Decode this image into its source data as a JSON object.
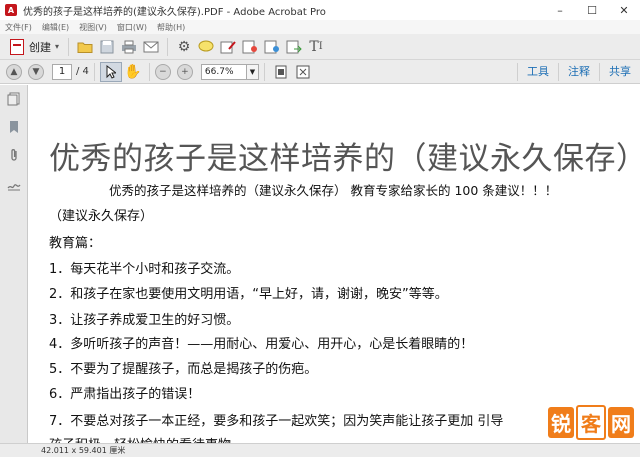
{
  "window": {
    "title": "优秀的孩子是这样培养的(建议永久保存).PDF - Adobe Acrobat Pro",
    "minimize": "–",
    "maximize": "☐",
    "close": "✕"
  },
  "menu": [
    "文件(F)",
    "编辑(E)",
    "视图(V)",
    "窗口(W)",
    "帮助(H)"
  ],
  "toolbar": {
    "create_label": "创建",
    "create_caret": "▾",
    "icons": [
      "open-folder-icon",
      "save-icon",
      "print-icon",
      "email-icon",
      "settings-icon",
      "comment-icon",
      "sign-icon",
      "stamp-icon",
      "attach-icon",
      "export-icon",
      "text-tool-icon"
    ]
  },
  "nav": {
    "current_page": "1",
    "total_pages": "/ 4",
    "zoom": "66.7%",
    "tabs": [
      "工具",
      "注释",
      "共享"
    ]
  },
  "document": {
    "title": "优秀的孩子是这样培养的（建议永久保存）",
    "subtitle": "优秀的孩子是这样培养的（建议永久保存）  教育专家给家长的 100 条建议！！！",
    "lines": [
      "（建议永久保存）",
      "教育篇：",
      "1．每天花半个小时和孩子交流。",
      "2．和孩子在家也要使用文明用语，“早上好，请，谢谢，晚安”等等。",
      "3．让孩子养成爱卫生的好习惯。",
      "4．多听听孩子的声音！——用耐心、用爱心、用开心，心是长着眼睛的！",
      "5．不要为了提醒孩子，而总是揭孩子的伤疤。",
      "6．严肃指出孩子的错误！",
      "7．不要总对孩子一本正经，要多和孩子一起欢笑；因为笑声能让孩子更加   引导",
      "孩子积极、轻松愉快的看待事物"
    ]
  },
  "watermark": [
    "锐",
    "客",
    "网"
  ],
  "status": {
    "dimensions": "42.011 x 59.401 厘米"
  }
}
